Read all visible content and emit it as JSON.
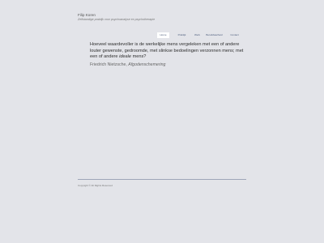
{
  "header": {
    "title": "Filip Koren",
    "subtitle": "Zelfstandige praktijk voor psychoanalyse en psychotherapie"
  },
  "nav": {
    "items": [
      {
        "label": "Home",
        "active": true
      },
      {
        "label": "Praktijk"
      },
      {
        "label": "Werk"
      },
      {
        "label": "Bereikbaarheid"
      },
      {
        "label": "Contact"
      }
    ]
  },
  "main": {
    "quote_before": "Hoeveel waardevoller is de werkelijke mens vergeleken met een of andere louter gewenste, gedroomde, met slinkse bedoelingen verzonnen mens; met een of andere ",
    "quote_em": "ideale",
    "quote_after": " mens?",
    "author": "Friedrich Nietzsche, ",
    "source": "Afgodenschemering"
  },
  "footer": {
    "copyright": "Copyright © All Rights Reserved"
  }
}
